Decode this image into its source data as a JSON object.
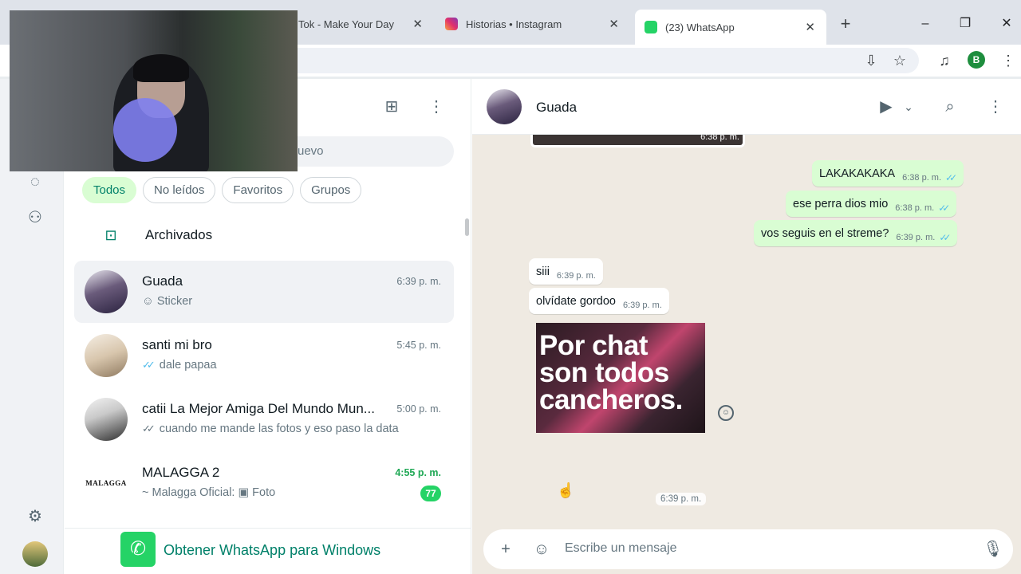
{
  "browser": {
    "tabs": [
      {
        "label": "Tok - Make Your Day",
        "close": "✕"
      },
      {
        "label": "Historias • Instagram",
        "close": "✕"
      },
      {
        "label": "(23) WhatsApp",
        "close": "✕"
      }
    ],
    "new_tab": "+",
    "window_controls": {
      "minimize": "–",
      "restore": "❐",
      "close": "✕"
    },
    "profile_initial": "B",
    "icons": [
      "install-app-icon",
      "bookmark-star-icon",
      "media-control-icon",
      "more-menu-icon"
    ]
  },
  "rail": {
    "icons": [
      "chats-icon",
      "status-icon",
      "channels-icon",
      "communities-icon",
      "settings-icon",
      "profile-avatar"
    ]
  },
  "chat_list": {
    "header_icons": [
      "new-chat-icon",
      "menu-icon"
    ],
    "search_placeholder_visible": "uevo",
    "filters": [
      "Todos",
      "No leídos",
      "Favoritos",
      "Grupos"
    ],
    "active_filter": "Todos",
    "archived_label": "Archivados",
    "chats": [
      {
        "name": "Guada",
        "time": "6:39 p. m.",
        "preview": "Sticker",
        "preview_icon": "sticker-icon",
        "selected": true
      },
      {
        "name": "santi mi bro",
        "time": "5:45 p. m.",
        "preview": "dale papaa",
        "ticks": "✓✓",
        "ticks_color": "#53bdeb"
      },
      {
        "name": "catii La Mejor Amiga Del Mundo Mun...",
        "time": "5:00 p. m.",
        "preview": "cuando me mande las fotos y eso paso la data",
        "ticks": "✓✓",
        "ticks_color": "#8696a0"
      },
      {
        "name": "MALAGGA 2",
        "avatar_text": "MALAGGA",
        "time": "4:55 p. m.",
        "sender": "~ Malagga Oficial:",
        "preview": "Foto",
        "preview_icon": "photo-icon",
        "unread": "77"
      }
    ],
    "banner": {
      "text": "Obtener WhatsApp para Windows"
    }
  },
  "conversation": {
    "contact": "Guada",
    "header_icons": [
      "video-call-icon",
      "chevron-down-icon",
      "search-icon",
      "menu-icon"
    ],
    "top_image_time": "6:38 p. m.",
    "messages": [
      {
        "dir": "out",
        "text": "LAKAKAKAKA",
        "time": "6:38 p. m.",
        "ticks": "✓✓"
      },
      {
        "dir": "out",
        "text": "ese perra dios mio",
        "time": "6:38 p. m.",
        "ticks": "✓✓"
      },
      {
        "dir": "out",
        "text": "vos seguis en el streme?",
        "time": "6:39 p. m.",
        "ticks": "✓✓"
      },
      {
        "dir": "in",
        "text": "siii",
        "time": "6:39 p. m."
      },
      {
        "dir": "in",
        "text": "olvídate gordoo",
        "time": "6:39 p. m."
      }
    ],
    "sticker": {
      "text": "Por chat\nson todos\ncancheros.",
      "time": "6:39 p. m."
    },
    "composer": {
      "placeholder": "Escribe un mensaje",
      "icons": [
        "plus-icon",
        "sticker-icon",
        "mic-icon"
      ]
    },
    "colors": {
      "outgoing": "#d9fdd3",
      "incoming": "#ffffff",
      "accent": "#25d366",
      "background": "#efeae2"
    }
  }
}
